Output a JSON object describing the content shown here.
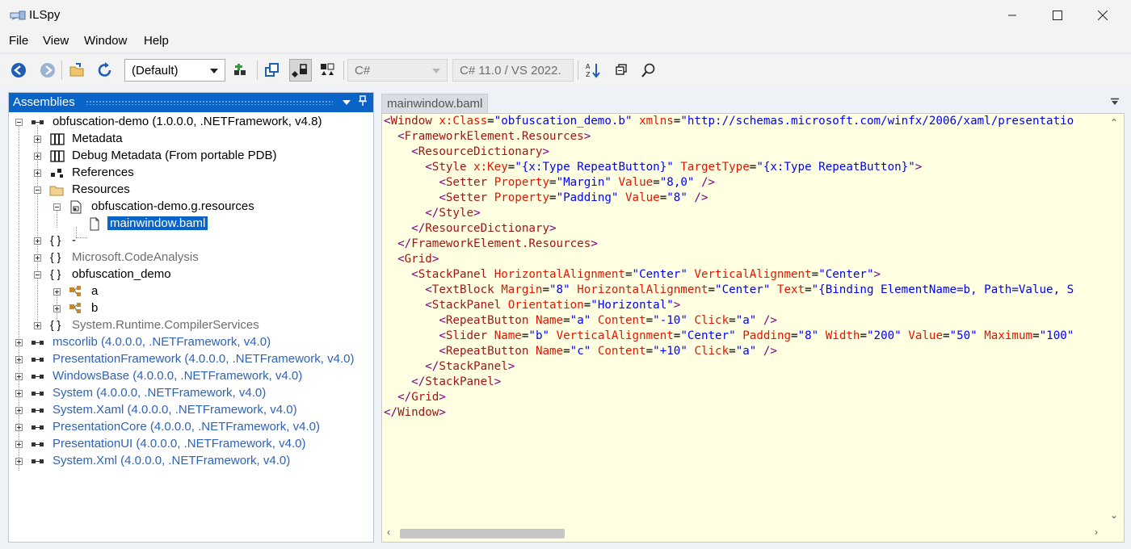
{
  "window": {
    "title": "ILSpy",
    "minimize_icon": "minimize-icon",
    "maximize_icon": "maximize-icon",
    "close_icon": "close-icon"
  },
  "menu": {
    "items": [
      "File",
      "View",
      "Window",
      "Help"
    ]
  },
  "toolbar": {
    "buttons": [
      "back-icon",
      "forward-icon",
      "open-folder-icon",
      "reload-icon",
      "add-assembly-icon",
      "sync-tree-icon",
      "show-public-only-icon",
      "show-all-members-icon",
      "sort-icon",
      "collapse-all-icon",
      "search-icon"
    ],
    "assembly_list": "(Default)",
    "language": "C#",
    "language_version": "C# 11.0 / VS 2022."
  },
  "assemblies_panel": {
    "title": "Assemblies",
    "tree": [
      "obfuscation-demo (1.0.0.0, .NETFramework, v4.8)",
      "Metadata",
      "Debug Metadata (From portable PDB)",
      "References",
      "Resources",
      "obfuscation-demo.g.resources",
      "mainwindow.baml",
      "-",
      "Microsoft.CodeAnalysis",
      "obfuscation_demo",
      "a",
      "b",
      "System.Runtime.CompilerServices",
      "mscorlib (4.0.0.0, .NETFramework, v4.0)",
      "PresentationFramework (4.0.0.0, .NETFramework, v4.0)",
      "WindowsBase (4.0.0.0, .NETFramework, v4.0)",
      "System (4.0.0.0, .NETFramework, v4.0)",
      "System.Xaml (4.0.0.0, .NETFramework, v4.0)",
      "PresentationCore (4.0.0.0, .NETFramework, v4.0)",
      "PresentationUI (4.0.0.0, .NETFramework, v4.0)",
      "System.Xml (4.0.0.0, .NETFramework, v4.0)"
    ],
    "namespace_icon": "{ }"
  },
  "editor": {
    "tab": "mainwindow.baml",
    "code": [
      "<Window x:Class=\"obfuscation_demo.b\" xmlns=\"http://schemas.microsoft.com/winfx/2006/xaml/presentatio",
      "  <FrameworkElement.Resources>",
      "    <ResourceDictionary>",
      "      <Style x:Key=\"{x:Type RepeatButton}\" TargetType=\"{x:Type RepeatButton}\">",
      "        <Setter Property=\"Margin\" Value=\"8,0\" />",
      "        <Setter Property=\"Padding\" Value=\"8\" />",
      "      </Style>",
      "    </ResourceDictionary>",
      "  </FrameworkElement.Resources>",
      "  <Grid>",
      "    <StackPanel HorizontalAlignment=\"Center\" VerticalAlignment=\"Center\">",
      "      <TextBlock Margin=\"8\" HorizontalAlignment=\"Center\" Text=\"{Binding ElementName=b, Path=Value, S",
      "      <StackPanel Orientation=\"Horizontal\">",
      "        <RepeatButton Name=\"a\" Content=\"-10\" Click=\"a\" />",
      "        <Slider Name=\"b\" VerticalAlignment=\"Center\" Padding=\"8\" Width=\"200\" Value=\"50\" Maximum=\"100\"",
      "        <RepeatButton Name=\"c\" Content=\"+10\" Click=\"a\" />",
      "      </StackPanel>",
      "    </StackPanel>",
      "  </Grid>",
      "</Window>"
    ]
  },
  "colors": {
    "accent": "#0a64c8",
    "editor_background": "#ffffe1",
    "xml_tag": "#a31515",
    "xml_attribute": "#e51400",
    "xml_value": "#0000ff",
    "tree_blue": "#2f63b5"
  }
}
